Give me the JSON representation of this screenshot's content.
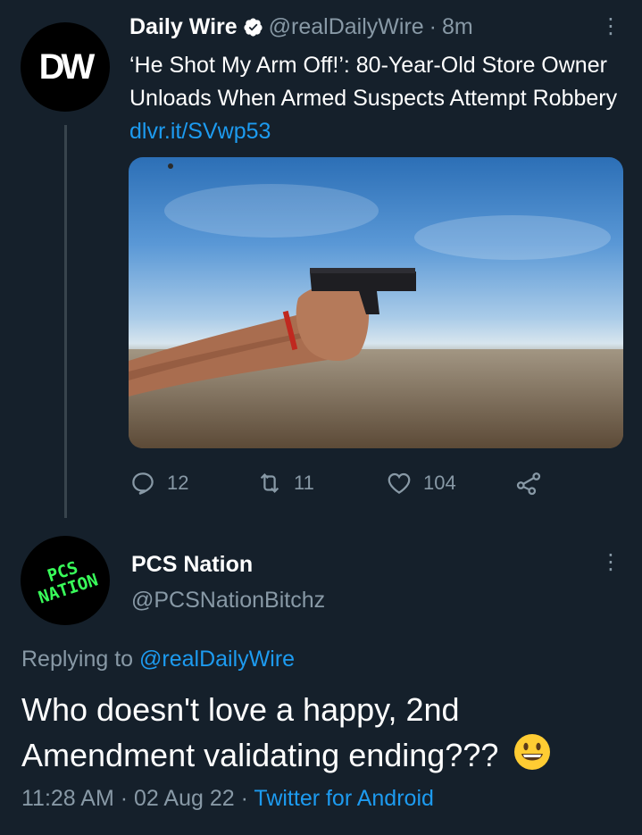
{
  "tweet": {
    "avatar_text": "DW",
    "author_name": "Daily Wire",
    "handle": "@realDailyWire",
    "separator": "·",
    "time": "8m",
    "text": "‘He Shot My Arm Off!’: 80-Year-Old Store Owner Unloads When Armed Suspects Attempt Robbery",
    "link": "dlvr.it/SVwp53",
    "actions": {
      "replies": "12",
      "retweets": "11",
      "likes": "104"
    }
  },
  "reply": {
    "avatar_text_line1": "PCS",
    "avatar_text_line2": "NATION",
    "author_name": "PCS Nation",
    "handle": "@PCSNationBitchz",
    "replying_label": "Replying to",
    "replying_handle": "@realDailyWire",
    "body": "Who doesn't love a happy, 2nd Amendment validating ending???",
    "emoji": "smiling-face-emoji",
    "time": "11:28 AM",
    "date": "02 Aug 22",
    "dot": "·",
    "source": "Twitter for Android"
  },
  "colors": {
    "background": "#15202b",
    "muted": "#8899a6",
    "link": "#1d9bf0",
    "verified": "#ffffff"
  }
}
